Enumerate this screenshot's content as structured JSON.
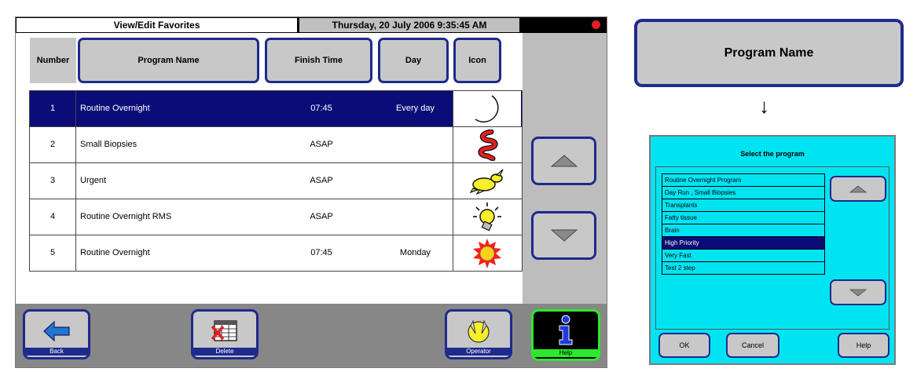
{
  "screen": {
    "title": "View/Edit Favorites",
    "datetime": "Thursday, 20 July 2006 9:35:45 AM",
    "columns": {
      "number": "Number",
      "program_name": "Program Name",
      "finish_time": "Finish Time",
      "day": "Day",
      "icon": "Icon"
    },
    "rows": [
      {
        "number": "1",
        "name": "Routine Overnight",
        "finish": "07:45",
        "day": "Every day",
        "icon": "moon-icon",
        "selected": true
      },
      {
        "number": "2",
        "name": "Small Biopsies",
        "finish": "ASAP",
        "day": "",
        "icon": "intestine-icon",
        "selected": false
      },
      {
        "number": "3",
        "name": "Urgent",
        "finish": "ASAP",
        "day": "",
        "icon": "rabbit-icon",
        "selected": false
      },
      {
        "number": "4",
        "name": "Routine Overnight RMS",
        "finish": "ASAP",
        "day": "",
        "icon": "lightbulb-icon",
        "selected": false
      },
      {
        "number": "5",
        "name": "Routine Overnight",
        "finish": "07:45",
        "day": "Monday",
        "icon": "sun-icon",
        "selected": false
      }
    ],
    "bottom_buttons": {
      "back": "Back",
      "delete": "Delete",
      "operator": "Operator",
      "help": "Help"
    }
  },
  "callout": {
    "button_label": "Program Name",
    "arrow": "↓"
  },
  "dialog": {
    "title": "Select the program",
    "programs": [
      {
        "label": "Routine Overnight Program",
        "selected": false
      },
      {
        "label": "Day Run , Small Biopsies",
        "selected": false
      },
      {
        "label": "Transplants",
        "selected": false
      },
      {
        "label": "Fatty tissue",
        "selected": false
      },
      {
        "label": "Brain",
        "selected": false
      },
      {
        "label": "High Priority",
        "selected": true
      },
      {
        "label": "Very Fast",
        "selected": false
      },
      {
        "label": "Test 2 step",
        "selected": false
      }
    ],
    "ok_label": "OK",
    "cancel_label": "Cancel",
    "help_label": "Help"
  },
  "colors": {
    "selection": "#0c0c78",
    "button_border": "#1e2a8c",
    "dialog_background": "#00e4f2",
    "help_accent": "#2ee82e"
  }
}
